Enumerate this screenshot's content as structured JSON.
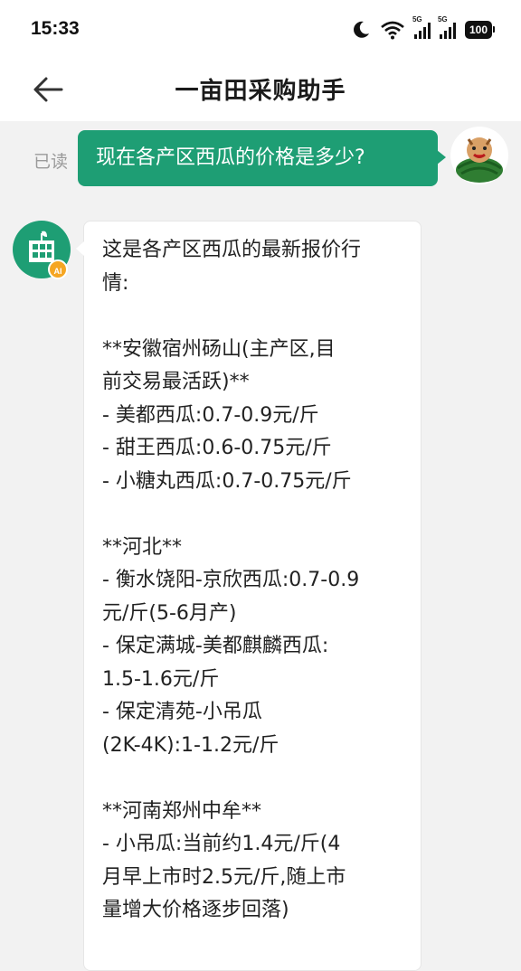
{
  "status_bar": {
    "time": "15:33",
    "battery": "100",
    "network_1": "5G",
    "network_2": "5G",
    "icons": [
      "moon-icon",
      "wifi-icon",
      "signal-icon",
      "signal-icon",
      "battery-icon"
    ]
  },
  "header": {
    "title": "一亩田采购助手",
    "back_icon": "arrow-left-icon"
  },
  "chat": {
    "read_label": "已读",
    "user_message": "现在各产区西瓜的价格是多少?",
    "ai_badge": "AI",
    "ai_lines": [
      "这是各产区西瓜的最新报价行",
      "情:",
      "",
      "**安徽宿州砀山(主产区,目",
      "前交易最活跃)**",
      "- 美都西瓜:0.7-0.9元/斤",
      "- 甜王西瓜:0.6-0.75元/斤",
      "- 小糖丸西瓜:0.7-0.75元/斤",
      "",
      "**河北**",
      "- 衡水饶阳-京欣西瓜:0.7-0.9",
      "元/斤(5-6月产)",
      "- 保定满城-美都麒麟西瓜:",
      "1.5-1.6元/斤",
      "- 保定清苑-小吊瓜",
      "(2K-4K):1-1.2元/斤",
      "",
      "**河南郑州中牟**",
      "- 小吊瓜:当前约1.4元/斤(4",
      "月早上市时2.5元/斤,随上市",
      "量增大价格逐步回落)"
    ]
  },
  "colors": {
    "accent_green": "#1e9e74",
    "badge_orange": "#f5a623",
    "background": "#f2f2f2"
  }
}
